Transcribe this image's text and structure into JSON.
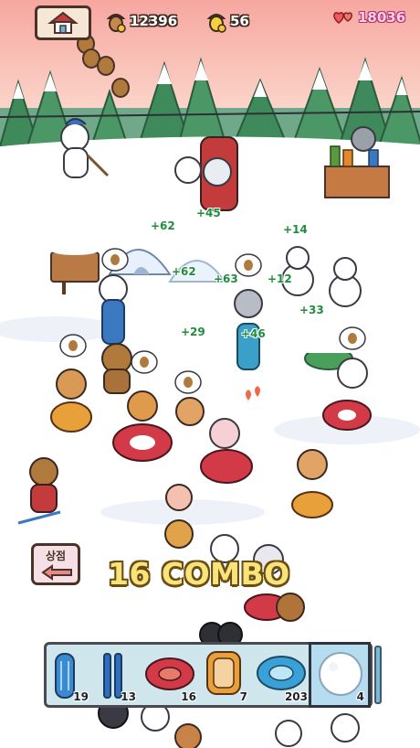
{
  "hud": {
    "home_icon": "house-icon",
    "acorns": "12396",
    "acorn_icon": "acorn-icon",
    "golden_acorns": "56",
    "golden_acorn_icon": "golden-acorn-icon",
    "hearts": "18036",
    "hearts_icon": "hearts-icon"
  },
  "floating_points": [
    "+62",
    "+45",
    "+14",
    "+62",
    "+63",
    "+12",
    "+33",
    "+29",
    "+46"
  ],
  "combo_text": "16 COMBO",
  "exit_sign": {
    "label": "상점",
    "icon": "left-arrow-icon"
  },
  "inventory": {
    "items": [
      {
        "name": "blue-sled",
        "count": "19"
      },
      {
        "name": "ski-pair",
        "count": "13"
      },
      {
        "name": "red-tube",
        "count": "16"
      },
      {
        "name": "orange-tube",
        "count": "7"
      },
      {
        "name": "blue-tube",
        "count": "203"
      },
      {
        "name": "snowball",
        "count": "4"
      }
    ],
    "selected_index": 5
  },
  "colors": {
    "sky_top": "#f6a7a0",
    "sky_bottom": "#fde0d4",
    "snow": "#ffffff",
    "tree": "#3f8a5a",
    "accent_green": "#1f8e3c",
    "combo_yellow": "#f9e37b"
  }
}
